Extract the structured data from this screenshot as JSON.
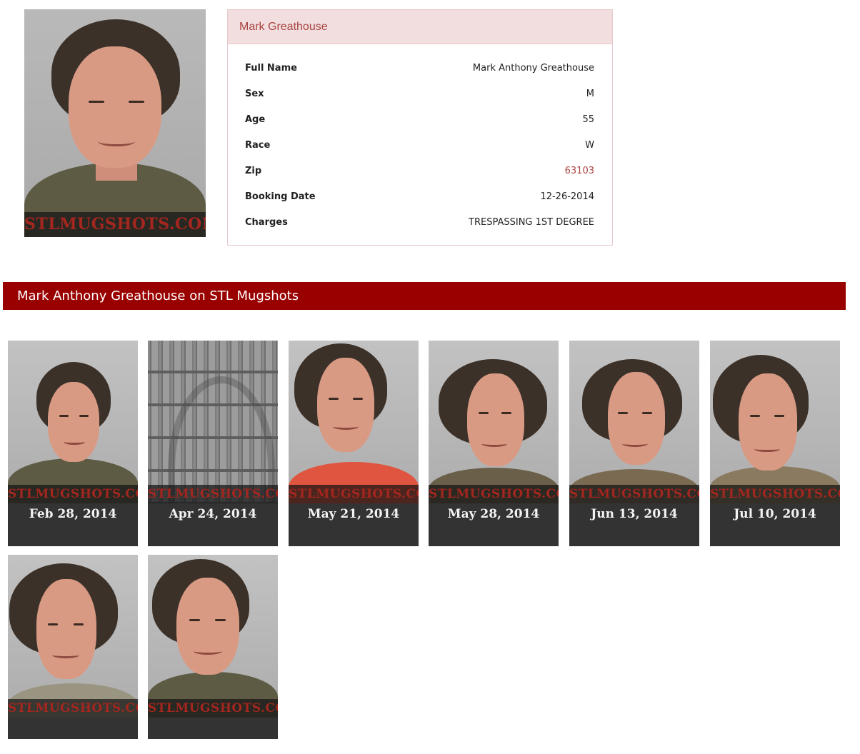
{
  "profile": {
    "name": "Mark Greathouse",
    "fields": [
      {
        "key": "Full Name",
        "value": "Mark Anthony Greathouse"
      },
      {
        "key": "Sex",
        "value": "M"
      },
      {
        "key": "Age",
        "value": "55"
      },
      {
        "key": "Race",
        "value": "W"
      },
      {
        "key": "Zip",
        "value": "63103"
      },
      {
        "key": "Booking Date",
        "value": "12-26-2014"
      },
      {
        "key": "Charges",
        "value": "TRESPASSING 1ST DEGREE"
      }
    ],
    "watermark": "STLMUGSHOTS.COM"
  },
  "banner": {
    "title": "Mark Anthony Greathouse on STL Mugshots"
  },
  "gallery": [
    {
      "date": "Feb 28, 2014",
      "watermark": "STLMUGSHOTS.COM"
    },
    {
      "date": "Apr 24, 2014",
      "watermark": "STLMUGSHOTS.COM"
    },
    {
      "date": "May 21, 2014",
      "watermark": "STLMUGSHOTS.COM"
    },
    {
      "date": "May 28, 2014",
      "watermark": "STLMUGSHOTS.COM"
    },
    {
      "date": "Jun 13, 2014",
      "watermark": "STLMUGSHOTS.COM"
    },
    {
      "date": "Jul 10, 2014",
      "watermark": "STLMUGSHOTS.COM"
    },
    {
      "date": "",
      "watermark": "STLMUGSHOTS.COM"
    },
    {
      "date": "",
      "watermark": "STLMUGSHOTS.COM"
    }
  ],
  "colors": {
    "accent": "#990000",
    "card_header": "#f2dede",
    "card_header_text": "#a94442",
    "thumb_bg": "#333333"
  }
}
